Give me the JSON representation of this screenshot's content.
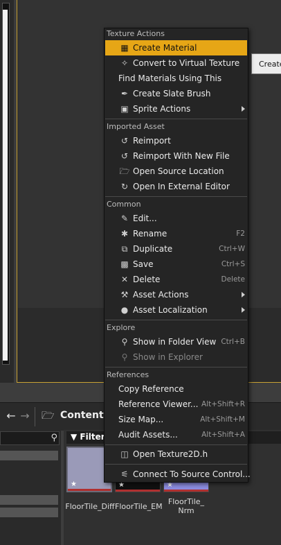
{
  "background": {
    "tooltip_text": "Create",
    "content_label": "Content",
    "filters_label": "Filters",
    "thumbnails": [
      {
        "name": "FloorTile_Diff",
        "caption": "FloorTile_Diff"
      },
      {
        "name": "FloorTile_EM",
        "caption": "FloorTile_EM"
      },
      {
        "name": "FloorTile_Nrm",
        "caption_line1": "FloorTile_",
        "caption_line2": "Nrm"
      }
    ]
  },
  "menu": {
    "sections": {
      "texture_actions": "Texture Actions",
      "imported_asset": "Imported Asset",
      "common": "Common",
      "explore": "Explore",
      "references": "References"
    },
    "items": {
      "create_material": {
        "label": "Create Material",
        "icon": "material-icon"
      },
      "convert_vt": {
        "label": "Convert to Virtual Texture",
        "icon": "virtual-texture-icon"
      },
      "find_materials": {
        "label": "Find Materials Using This"
      },
      "create_slate_brush": {
        "label": "Create Slate Brush",
        "icon": "brush-icon"
      },
      "sprite_actions": {
        "label": "Sprite Actions",
        "icon": "sprite-icon"
      },
      "reimport": {
        "label": "Reimport",
        "icon": "reimport-icon"
      },
      "reimport_new_file": {
        "label": "Reimport With New File",
        "icon": "reimport-icon"
      },
      "open_source_location": {
        "label": "Open Source Location",
        "icon": "folder-icon"
      },
      "open_external_editor": {
        "label": "Open In External Editor",
        "icon": "external-editor-icon"
      },
      "edit": {
        "label": "Edit...",
        "icon": "pencil-icon"
      },
      "rename": {
        "label": "Rename",
        "icon": "rename-icon",
        "shortcut": "F2"
      },
      "duplicate": {
        "label": "Duplicate",
        "icon": "duplicate-icon",
        "shortcut": "Ctrl+W"
      },
      "save": {
        "label": "Save",
        "icon": "save-icon",
        "shortcut": "Ctrl+S"
      },
      "delete": {
        "label": "Delete",
        "icon": "close-icon",
        "shortcut": "Delete"
      },
      "asset_actions": {
        "label": "Asset Actions",
        "icon": "wrench-icon"
      },
      "asset_localization": {
        "label": "Asset Localization",
        "icon": "globe-icon"
      },
      "show_in_folder": {
        "label": "Show in Folder View",
        "icon": "search-icon",
        "shortcut": "Ctrl+B"
      },
      "show_in_explorer": {
        "label": "Show in Explorer",
        "icon": "search-icon"
      },
      "copy_reference": {
        "label": "Copy Reference"
      },
      "reference_viewer": {
        "label": "Reference Viewer...",
        "shortcut": "Alt+Shift+R"
      },
      "size_map": {
        "label": "Size Map...",
        "shortcut": "Alt+Shift+M"
      },
      "audit_assets": {
        "label": "Audit Assets...",
        "shortcut": "Alt+Shift+A"
      },
      "open_header": {
        "label": "Open Texture2D.h",
        "icon": "cpp-icon"
      },
      "source_control": {
        "label": "Connect To Source Control...",
        "icon": "source-control-icon"
      }
    }
  },
  "colors": {
    "highlight": "#e6a616",
    "menu_bg": "#252525"
  }
}
